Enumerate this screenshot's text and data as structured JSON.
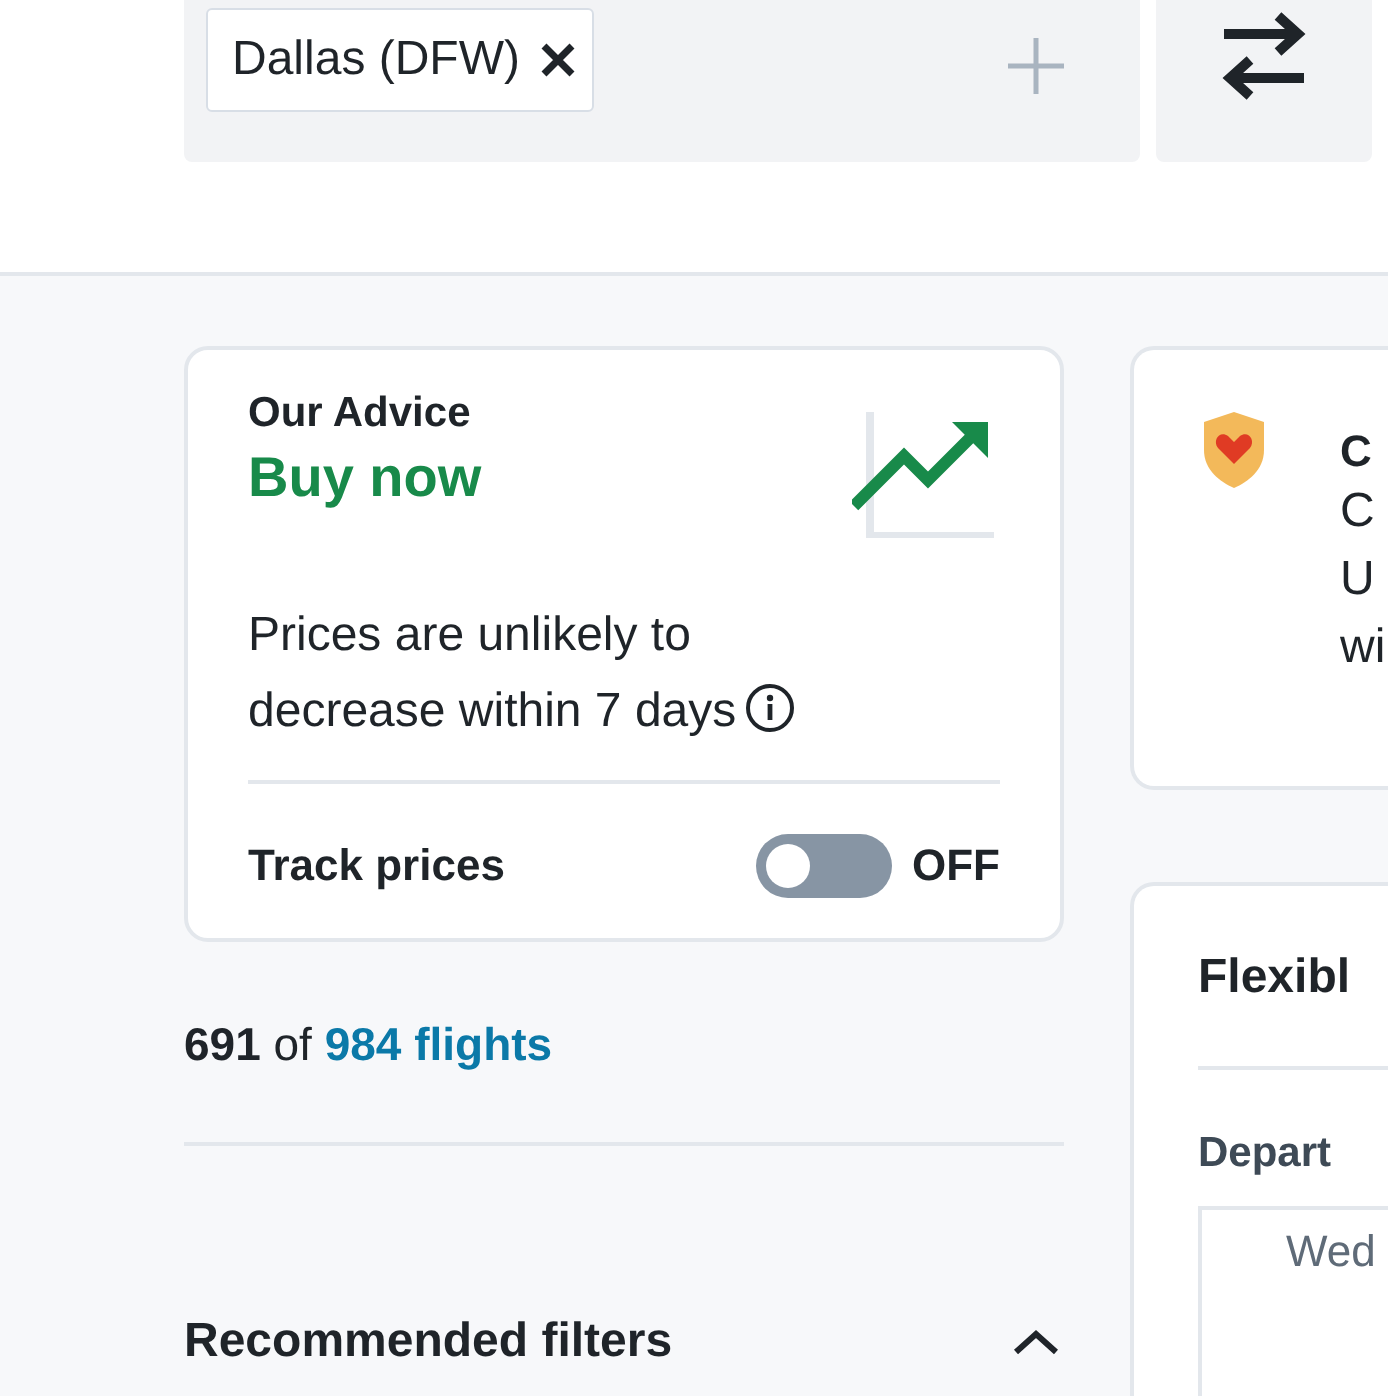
{
  "origin_field": {
    "chips": [
      {
        "label": "Dallas (DFW)"
      }
    ]
  },
  "advice": {
    "heading": "Our Advice",
    "verdict": "Buy now",
    "message": "Prices are unlikely to decrease within 7 days",
    "track_label": "Track prices",
    "track_on": false,
    "track_state": "OFF"
  },
  "results": {
    "count": "**691** of",
    "total": "984 flights"
  },
  "filters": {
    "title": "Recommended filters",
    "expanded": true
  },
  "notice": {
    "title": "C",
    "lines": [
      "C",
      "U",
      "wi"
    ]
  },
  "flexible": {
    "title": "Flexibl",
    "depart_label": "Depart",
    "day": "Wed"
  }
}
